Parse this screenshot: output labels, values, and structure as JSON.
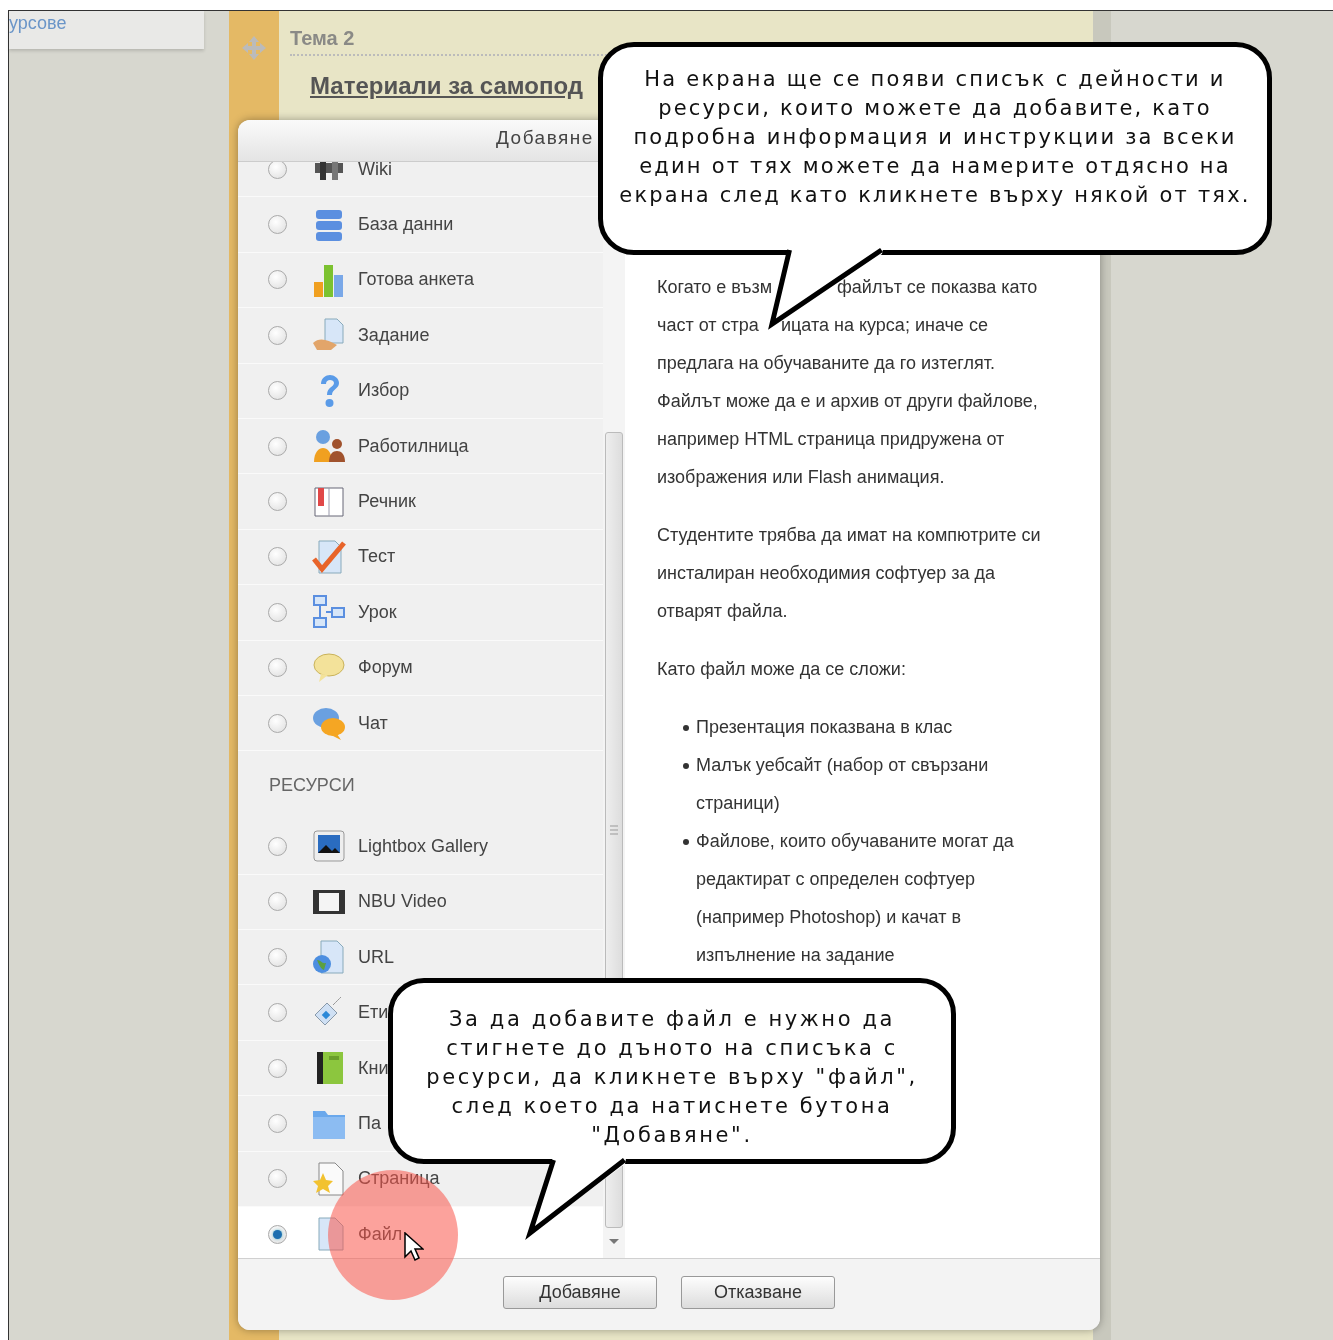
{
  "sidebar": {
    "link": "урсове"
  },
  "section": {
    "title": "Тема 2",
    "heading": "Материали за самопод"
  },
  "dialog": {
    "title": "Добавяне",
    "options": [
      {
        "kind": "option",
        "label": "Wiki",
        "selected": false
      },
      {
        "kind": "option",
        "label": "База данни",
        "selected": false
      },
      {
        "kind": "option",
        "label": "Готова анкета",
        "selected": false
      },
      {
        "kind": "option",
        "label": "Задание",
        "selected": false
      },
      {
        "kind": "option",
        "label": "Избор",
        "selected": false
      },
      {
        "kind": "option",
        "label": "Работилница",
        "selected": false
      },
      {
        "kind": "option",
        "label": "Речник",
        "selected": false
      },
      {
        "kind": "option",
        "label": "Тест",
        "selected": false
      },
      {
        "kind": "option",
        "label": "Урок",
        "selected": false
      },
      {
        "kind": "option",
        "label": "Форум",
        "selected": false
      },
      {
        "kind": "option",
        "label": "Чат",
        "selected": false
      },
      {
        "kind": "heading",
        "label": "РЕСУРСИ"
      },
      {
        "kind": "option",
        "label": "Lightbox Gallery",
        "selected": false
      },
      {
        "kind": "option",
        "label": "NBU Video",
        "selected": false
      },
      {
        "kind": "option",
        "label": "URL",
        "selected": false
      },
      {
        "kind": "option",
        "label": "Ети",
        "selected": false
      },
      {
        "kind": "option",
        "label": "Кни",
        "selected": false
      },
      {
        "kind": "option",
        "label": "Па",
        "selected": false
      },
      {
        "kind": "option",
        "label": "Страница",
        "selected": false
      },
      {
        "kind": "option",
        "label": "Файл",
        "selected": true
      }
    ],
    "description": [
      {
        "kind": "split",
        "lines": [
          [
            "Когато е възм",
            "файлът се показва като"
          ],
          [
            "част от стра",
            "ицата на курса; иначе се"
          ]
        ]
      },
      {
        "kind": "continuation",
        "lines": [
          "предлага на обучаваните да го изтеглят.",
          "Файлът може да е и архив от други файлове,",
          "например HTML страница придружена от",
          "изображения или Flash анимация."
        ]
      },
      {
        "kind": "paragraph",
        "lines": [
          "Студентите трябва да имат на компютрите си",
          "инсталиран необходимия софтуер за да",
          "отварят файла."
        ]
      },
      {
        "kind": "paragraph",
        "lines": [
          "Като файл може да се сложи:"
        ]
      },
      {
        "kind": "bullets",
        "items": [
          [
            "Презентация показвана в клас"
          ],
          [
            "Малък уебсайт (набор от свързани",
            "страници)"
          ],
          [
            "Файлове, които обучаваните могат да",
            "редактират с определен софтуер",
            "(например Photoshop) и качат в",
            "изпълнение на задание"
          ]
        ]
      }
    ],
    "buttons": [
      "Добавяне",
      "Отказване"
    ]
  },
  "callouts": [
    {
      "text": "На екрана ще се появи списък с дейности и ресурси, които можете да добавите, като подробна информация и инструкции за всеки един от тях можете да намерите отдясно на екрана след като кликнете върху някой от тях."
    },
    {
      "text": "За да добавите файл е нужно да стигнете до дъното на списъка с ресурси, да кликнете върху \"файл\", след което да натиснете бутона \"Добавяне\"."
    }
  ]
}
